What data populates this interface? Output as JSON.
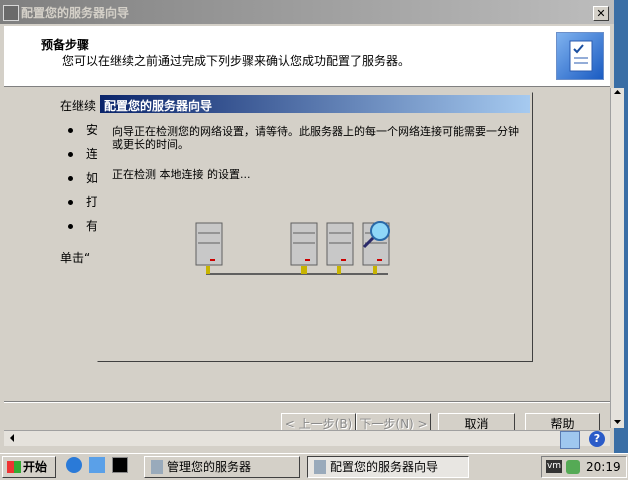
{
  "window": {
    "title": "配置您的服务器向导",
    "close_glyph": "✕",
    "header_title": "预备步骤",
    "header_subtitle": "您可以在继续之前通过完成下列步骤来确认您成功配置了服务器。",
    "body_intro": "在继续",
    "bullets": [
      "安",
      "连",
      "如",
      "打",
      "有"
    ],
    "body_click": "单击“",
    "buttons": {
      "back": "< 上一步(B)",
      "next": "下一步(N) >",
      "cancel": "取消",
      "help": "帮助"
    }
  },
  "dialog": {
    "title": "配置您的服务器向导",
    "message": "向导正在检测您的网络设置，请等待。此服务器上的每一个网络连接可能需要一分钟或更长的时间。",
    "status": "正在检测 本地连接 的设置..."
  },
  "taskbar": {
    "start_label": "开始",
    "tasks": [
      "管理您的服务器",
      "配置您的服务器向导"
    ],
    "clock": "20:19",
    "quick_launch_icons": [
      "ie-icon",
      "explorer-icon",
      "cmd-icon"
    ],
    "tray_icons": [
      "vmware-icon",
      "network-icon"
    ]
  },
  "colors": {
    "desktop": "#3a6ea5",
    "dialog_title_start": "#0a246a",
    "dialog_title_end": "#a6caf0"
  }
}
